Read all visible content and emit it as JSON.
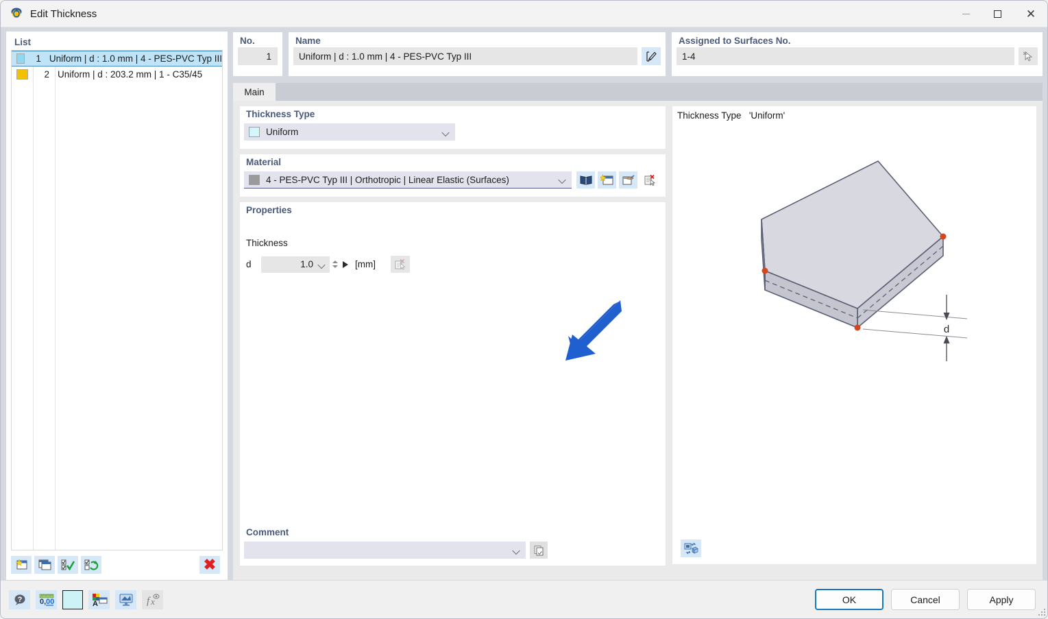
{
  "window": {
    "title": "Edit Thickness",
    "app_icon": "thickness-app-icon",
    "controls": {
      "minimize": "minimize-icon",
      "maximize": "maximize-icon",
      "close": "close-icon"
    }
  },
  "list": {
    "title": "List",
    "rows": [
      {
        "num": "1",
        "label": "Uniform | d : 1.0 mm | 4 - PES-PVC Typ III",
        "color": "#8ed8f0",
        "selected": true
      },
      {
        "num": "2",
        "label": "Uniform | d : 203.2 mm | 1 - C35/45",
        "color": "#f2c200",
        "selected": false
      }
    ],
    "toolbar": [
      {
        "name": "new-thickness-button",
        "icon": "new-window-star-icon"
      },
      {
        "name": "copy-thickness-button",
        "icon": "copy-window-icon"
      },
      {
        "name": "select-all-button",
        "icon": "check-all-icon"
      },
      {
        "name": "invert-selection-button",
        "icon": "refresh-check-icon"
      },
      {
        "name": "delete-thickness-button",
        "icon": "red-x-icon"
      }
    ]
  },
  "header": {
    "no": {
      "label": "No.",
      "value": "1"
    },
    "name": {
      "label": "Name",
      "value": "Uniform | d : 1.0 mm | 4 - PES-PVC Typ III",
      "edit_icon": "edit-pencil-icon"
    },
    "assigned": {
      "label": "Assigned to Surfaces No.",
      "value": "1-4",
      "pick_icon": "pick-cursor-icon"
    }
  },
  "tabs": [
    {
      "label": "Main",
      "active": true
    }
  ],
  "main": {
    "thickness_type": {
      "label": "Thickness Type",
      "value": "Uniform",
      "swatch": "#d4f6fa"
    },
    "material": {
      "label": "Material",
      "value": "4 - PES-PVC Typ III | Orthotropic | Linear Elastic (Surfaces)",
      "swatch": "#9a9a9a",
      "tools": [
        {
          "name": "material-library-button",
          "icon": "book-icon"
        },
        {
          "name": "new-material-button",
          "icon": "new-window-star-icon"
        },
        {
          "name": "edit-material-button",
          "icon": "edit-material-icon"
        },
        {
          "name": "delete-material-button",
          "icon": "delete-document-icon"
        }
      ]
    },
    "properties": {
      "label": "Properties",
      "thickness_group": "Thickness",
      "symbol": "d",
      "value": "1.0",
      "unit": "[mm]",
      "clear_icon": "clear-value-icon"
    },
    "comment": {
      "label": "Comment",
      "value": "",
      "copy_icon": "copy-comment-icon"
    }
  },
  "preview": {
    "caption_prefix": "Thickness Type",
    "caption_value": "'Uniform'",
    "dimension_label": "d",
    "settings_icon": "preview-settings-icon",
    "surface_fill": "#d8d9e0",
    "edge_color": "#5a5f74",
    "node_color": "#d4461e"
  },
  "statusbar": {
    "tools": [
      {
        "name": "help-button",
        "icon": "help-balloon-icon"
      },
      {
        "name": "decimal-places-button",
        "icon": "number-format-icon"
      },
      {
        "name": "color-swatch-button",
        "icon": "color-swatch-icon",
        "color": "#cdf3f7"
      },
      {
        "name": "display-properties-button",
        "icon": "text-color-icon"
      },
      {
        "name": "render-view-button",
        "icon": "render-icon"
      },
      {
        "name": "formula-button",
        "icon": "fx-icon"
      }
    ],
    "buttons": {
      "ok": "OK",
      "cancel": "Cancel",
      "apply": "Apply"
    }
  },
  "annotation": {
    "type": "arrow",
    "color": "#1f5fd0",
    "points_to": "thickness-value-field"
  }
}
